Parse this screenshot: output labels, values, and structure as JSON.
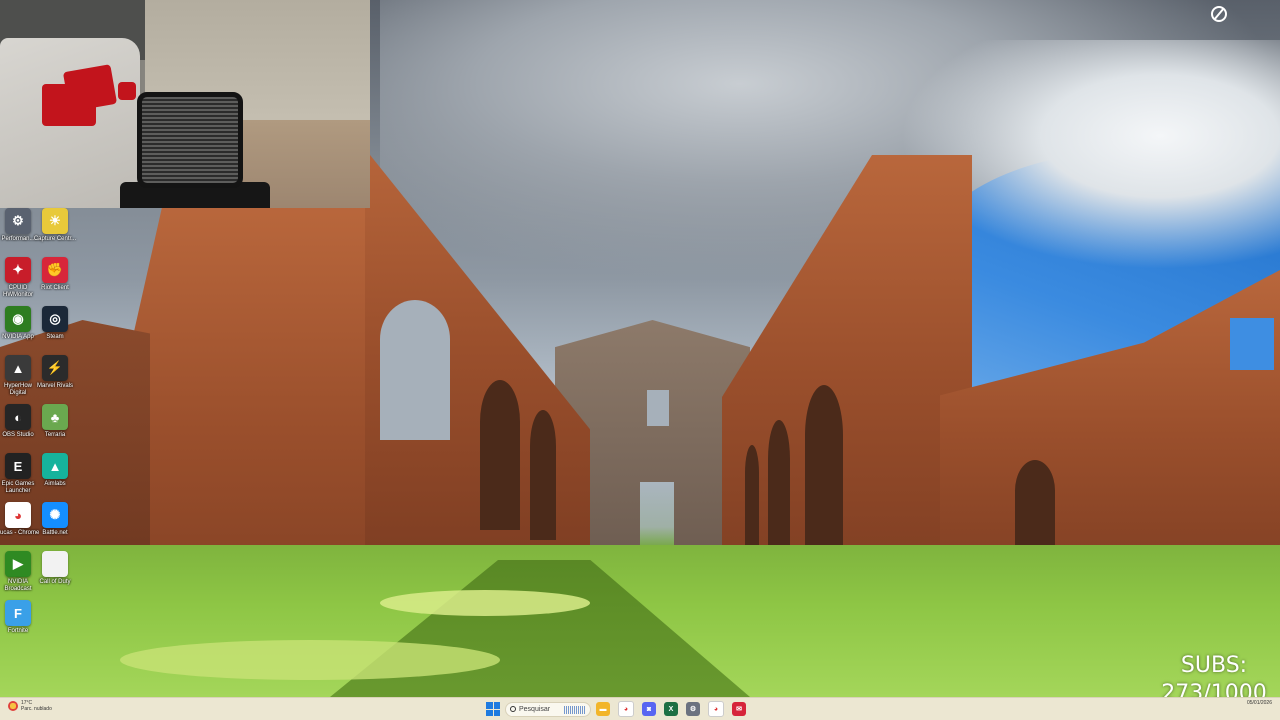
{
  "top_right_widget": {
    "label": "",
    "icon": "compass-icon"
  },
  "desktop_icons": [
    {
      "id": "performance",
      "label": "Performan...",
      "color": "#5a6270",
      "glyph": "⚙"
    },
    {
      "id": "capture",
      "label": "Capture Centr...",
      "color": "#e8c93a",
      "glyph": "☀"
    },
    {
      "id": "cpuid",
      "label": "CPUID HWMonitor",
      "color": "#c81d2a",
      "glyph": "✦"
    },
    {
      "id": "riot",
      "label": "Riot Client",
      "color": "#d8263a",
      "glyph": "✊"
    },
    {
      "id": "nvidia-app",
      "label": "NVIDIA App",
      "color": "#2e7d20",
      "glyph": "◉"
    },
    {
      "id": "steam",
      "label": "Steam",
      "color": "#1b2838",
      "glyph": "◎"
    },
    {
      "id": "hyperx",
      "label": "HyperHow Digital",
      "color": "#3a3a3a",
      "glyph": "▲"
    },
    {
      "id": "marvel-rivals",
      "label": "Marvel Rivals",
      "color": "#2b2b2b",
      "glyph": "⚡"
    },
    {
      "id": "obs",
      "label": "OBS Studio",
      "color": "#262626",
      "glyph": "◐"
    },
    {
      "id": "terraria",
      "label": "Terraria",
      "color": "#6aa84f",
      "glyph": "♣"
    },
    {
      "id": "epic",
      "label": "Epic Games Launcher",
      "color": "#222222",
      "glyph": "E"
    },
    {
      "id": "aimlabs",
      "label": "Aimlabs",
      "color": "#16b39c",
      "glyph": "▲"
    },
    {
      "id": "chrome",
      "label": "Lucas - Chrome",
      "color": "#ffffff",
      "glyph": "◕"
    },
    {
      "id": "battlenet",
      "label": "Battle.net",
      "color": "#148eff",
      "glyph": "✺"
    },
    {
      "id": "nvidia-broadcast",
      "label": "NVIDIA Broadcast",
      "color": "#2f8a22",
      "glyph": "▶"
    },
    {
      "id": "call-of-duty",
      "label": "Call of Duty",
      "color": "#f2f2f2",
      "glyph": ""
    },
    {
      "id": "fortnite",
      "label": "Fortnite",
      "color": "#3aa0e8",
      "glyph": "F"
    }
  ],
  "subs": {
    "label": "SUBS:",
    "count": "273/1000"
  },
  "taskbar": {
    "weather_temp": "17°C",
    "weather_desc": "Parc. nublado",
    "search_placeholder": "Pesquisar",
    "apps": [
      {
        "id": "explorer-icon",
        "color": "#f2b52a",
        "glyph": "▬"
      },
      {
        "id": "chrome-icon",
        "color": "#ffffff",
        "glyph": "◕"
      },
      {
        "id": "discord-icon",
        "color": "#5865f2",
        "glyph": "◙"
      },
      {
        "id": "excel-icon",
        "color": "#1d7044",
        "glyph": "X"
      },
      {
        "id": "settings-icon",
        "color": "#6b7280",
        "glyph": "⚙"
      },
      {
        "id": "chrome-profile-icon",
        "color": "#ffffff",
        "glyph": "◕"
      },
      {
        "id": "app-red-icon",
        "color": "#d6243a",
        "glyph": "✉"
      }
    ],
    "date": "05/01/2026"
  }
}
